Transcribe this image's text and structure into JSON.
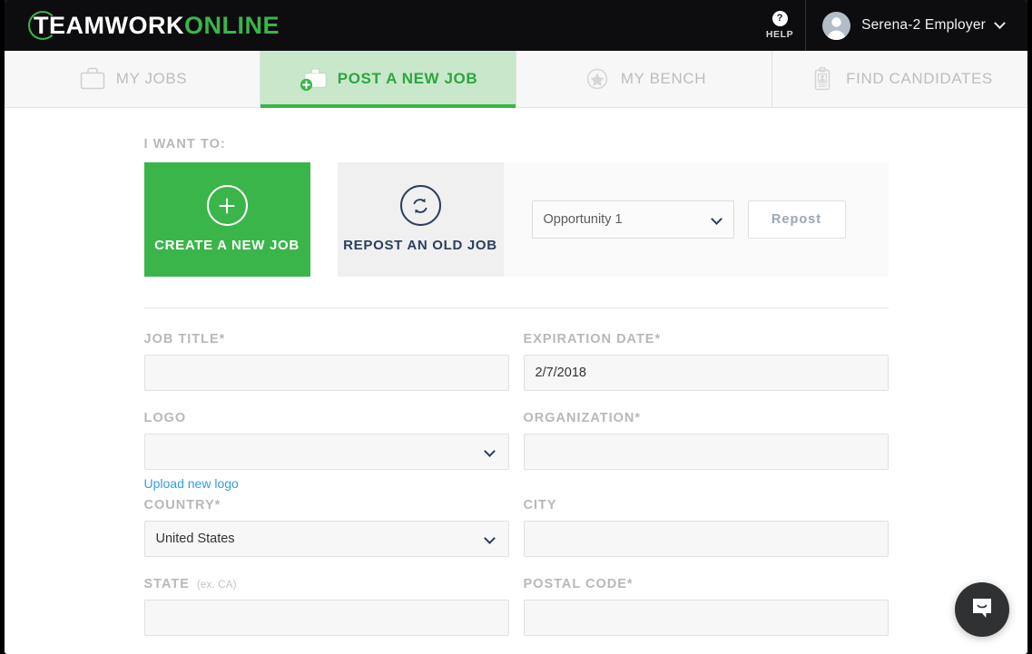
{
  "header": {
    "logo_primary": "TEAMWORK",
    "logo_secondary": "ONLINE",
    "help_label": "HELP",
    "help_glyph": "?",
    "user_name": "Serena-2 Employer"
  },
  "tabs": [
    {
      "label": "MY JOBS",
      "icon": "briefcase-icon",
      "active": false
    },
    {
      "label": "POST A NEW JOB",
      "icon": "briefcase-plus-icon",
      "active": true
    },
    {
      "label": "MY BENCH",
      "icon": "star-circle-icon",
      "active": false
    },
    {
      "label": "FIND CANDIDATES",
      "icon": "clipboard-person-icon",
      "active": false
    }
  ],
  "main": {
    "want_to_label": "I WANT TO:",
    "create_card": {
      "title": "CREATE A NEW JOB",
      "icon": "plus-circle-icon"
    },
    "repost_card": {
      "title": "REPOST AN OLD JOB",
      "icon": "refresh-circle-icon"
    },
    "repost_select_value": "Opportunity 1",
    "repost_button_label": "Repost"
  },
  "form": {
    "job_title": {
      "label": "JOB TITLE*",
      "value": "",
      "placeholder": ""
    },
    "expiration_date": {
      "label": "EXPIRATION DATE*",
      "value": "2/7/2018",
      "placeholder": ""
    },
    "logo": {
      "label": "LOGO",
      "value": "",
      "upload_link": "Upload new logo"
    },
    "organization": {
      "label": "ORGANIZATION*",
      "value": "",
      "placeholder": ""
    },
    "country": {
      "label": "COUNTRY*",
      "value": "United States"
    },
    "city": {
      "label": "CITY",
      "value": "",
      "placeholder": ""
    },
    "state": {
      "label": "STATE",
      "hint": "(ex. CA)",
      "value": "",
      "placeholder": ""
    },
    "postal_code": {
      "label": "POSTAL CODE*",
      "value": "",
      "placeholder": ""
    }
  },
  "widgets": {
    "chat_launcher": "chat-bubble-icon"
  },
  "colors": {
    "brand_green": "#3ab54a",
    "tab_active_bg": "#c9e8cb",
    "navy": "#2c3e5d",
    "link_blue": "#2f9fe0",
    "header_bg": "#0d0d10"
  }
}
